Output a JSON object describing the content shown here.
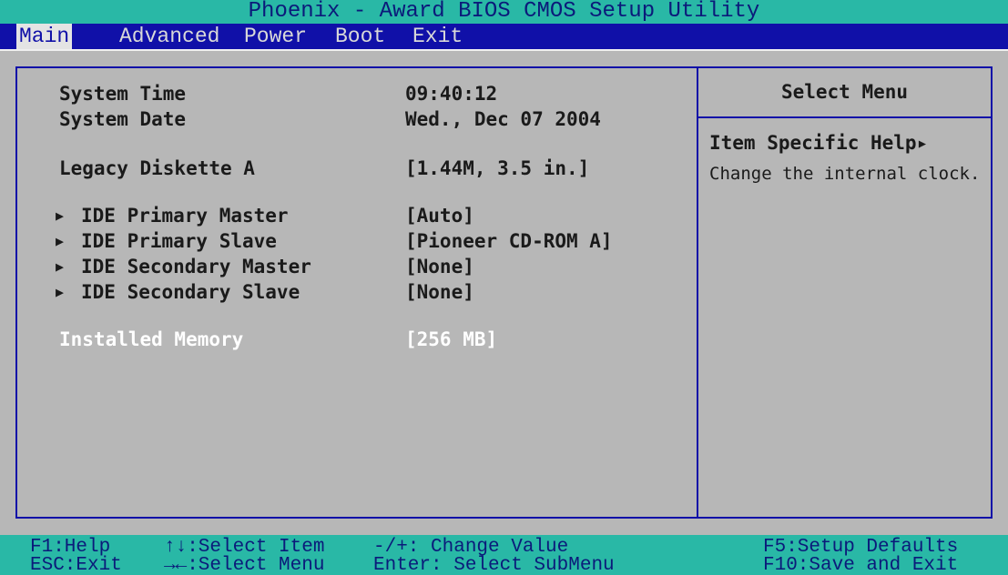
{
  "title": "Phoenix - Award BIOS CMOS Setup Utility",
  "menu": [
    "Main",
    "Advanced",
    "Power",
    "Boot",
    "Exit"
  ],
  "items": [
    {
      "label": "System Time",
      "value": "09:40:12"
    },
    {
      "label": "System Date",
      "value": "Wed., Dec 07 2004"
    },
    {
      "label": "Legacy Diskette A",
      "value": "[1.44M, 3.5 in.]"
    },
    {
      "label": "IDE Primary Master",
      "value": "[Auto]",
      "arrow": "▶"
    },
    {
      "label": "IDE Primary Slave",
      "value": "[Pioneer CD-ROM A]",
      "arrow": "▶"
    },
    {
      "label": "IDE Secondary Master",
      "value": "[None]",
      "arrow": "▶"
    },
    {
      "label": "IDE Secondary Slave",
      "value": "[None]",
      "arrow": "▶"
    },
    {
      "label": "Installed Memory",
      "value": "[256 MB]"
    }
  ],
  "help": {
    "title": "Select Menu",
    "header": "Item Specific Help▸",
    "text": "Change the internal clock."
  },
  "footer": {
    "f1": "F1:Help",
    "esc": "ESC:Exit",
    "select_item": "↑↓:Select Item",
    "select_menu": "→←:Select Menu",
    "change_value": "-/+: Change Value",
    "enter": "Enter: Select SubMenu",
    "f5": "F5:Setup Defaults",
    "f10": "F10:Save and Exit"
  },
  "colors": {
    "accent_teal": "#29b8a6",
    "menu_blue": "#1010a8",
    "panel_gray": "#b7b7b7"
  }
}
